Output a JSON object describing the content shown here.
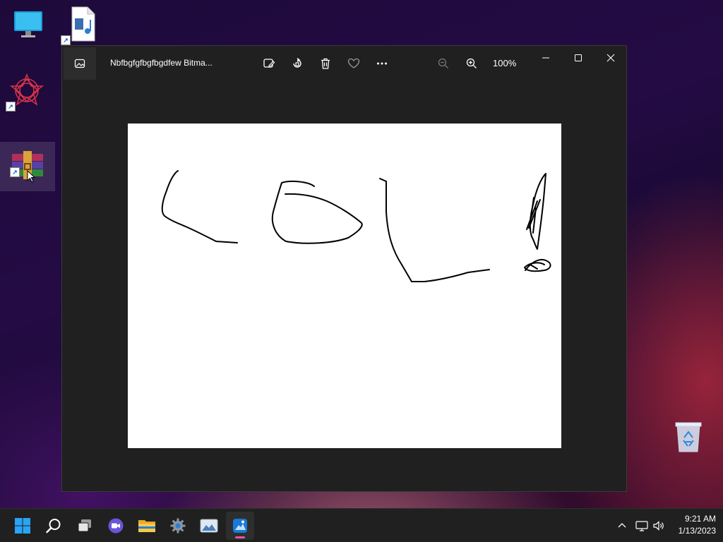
{
  "desktop": {
    "icons": [
      "this-pc",
      "media-file",
      "app-shortcut",
      "winrar-archive",
      "recycle-bin"
    ]
  },
  "window": {
    "title": "Nbfbgfgfbgfbgdfew Bitma...",
    "zoom_label": "100%",
    "toolbar_icons": [
      "edit-image-icon",
      "rotate-icon",
      "delete-icon",
      "favorite-icon",
      "more-icon",
      "zoom-out-icon",
      "zoom-in-icon"
    ]
  },
  "taskbar": {
    "apps": [
      "start",
      "search",
      "task-view",
      "meet",
      "file-explorer",
      "settings",
      "photos-viewer",
      "photos"
    ],
    "clock": {
      "time": "9:21 AM",
      "date": "1/13/2023"
    }
  },
  "colors": {
    "accent": "#0078d4",
    "active_indicator": "#e05a9a",
    "window_bg": "#202020"
  }
}
